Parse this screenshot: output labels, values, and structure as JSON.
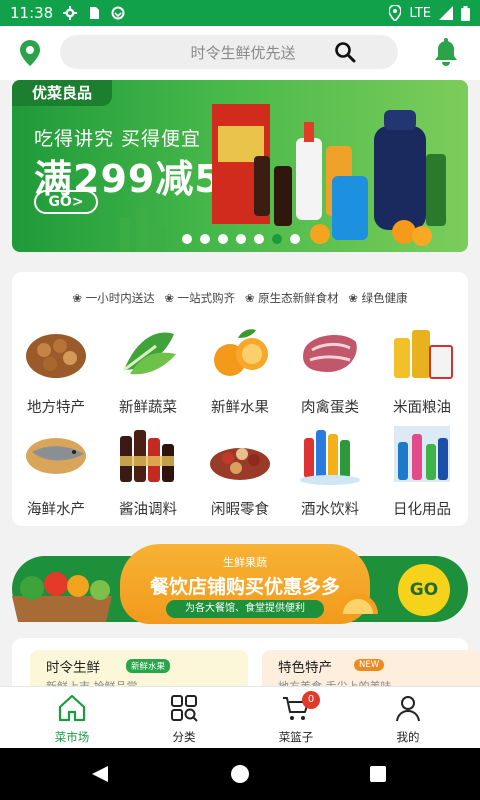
{
  "status_bar": {
    "time": "11:38",
    "network": "LTE"
  },
  "header": {
    "search_placeholder": "时令生鲜优先送"
  },
  "banner": {
    "brand": "优菜良品",
    "line1": "吃得讲究 买得便宜",
    "line2": "满299减50",
    "go_label": "GO>",
    "dot_count": 7,
    "active_dot": 6
  },
  "features": [
    "一小时内送达",
    "一站式购齐",
    "原生态新鲜食材",
    "绿色健康"
  ],
  "categories": [
    {
      "label": "地方特产",
      "icon": "nuts-icon"
    },
    {
      "label": "新鲜蔬菜",
      "icon": "vegetable-icon"
    },
    {
      "label": "新鲜水果",
      "icon": "orange-icon"
    },
    {
      "label": "肉禽蛋类",
      "icon": "meat-icon"
    },
    {
      "label": "米面粮油",
      "icon": "grain-oil-icon"
    },
    {
      "label": "海鲜水产",
      "icon": "fish-icon"
    },
    {
      "label": "酱油调料",
      "icon": "sauce-icon"
    },
    {
      "label": "闲暇零食",
      "icon": "snack-icon"
    },
    {
      "label": "酒水饮料",
      "icon": "drinks-icon"
    },
    {
      "label": "日化用品",
      "icon": "daily-goods-icon"
    }
  ],
  "promo": {
    "tag": "生鲜果蔬",
    "title": "餐饮店铺购买优惠多多",
    "subtitle": "为各大餐馆、食堂提供便利",
    "go_label": "GO"
  },
  "sections": [
    {
      "title": "时令生鲜",
      "badge": "新鲜水果",
      "desc": "新鲜上市 抢鲜品尝"
    },
    {
      "title": "特色特产",
      "badge": "NEW",
      "desc": "地方美食 舌尖上的美味"
    }
  ],
  "tabs": [
    {
      "label": "菜市场",
      "icon": "home-icon",
      "active": true
    },
    {
      "label": "分类",
      "icon": "category-icon"
    },
    {
      "label": "菜篮子",
      "icon": "cart-icon",
      "badge": "0"
    },
    {
      "label": "我的",
      "icon": "person-icon"
    }
  ],
  "colors": {
    "primary": "#1a9c3e",
    "status_bar": "#12a14b",
    "accent_orange": "#f29a1d",
    "badge_red": "#e3392a"
  }
}
